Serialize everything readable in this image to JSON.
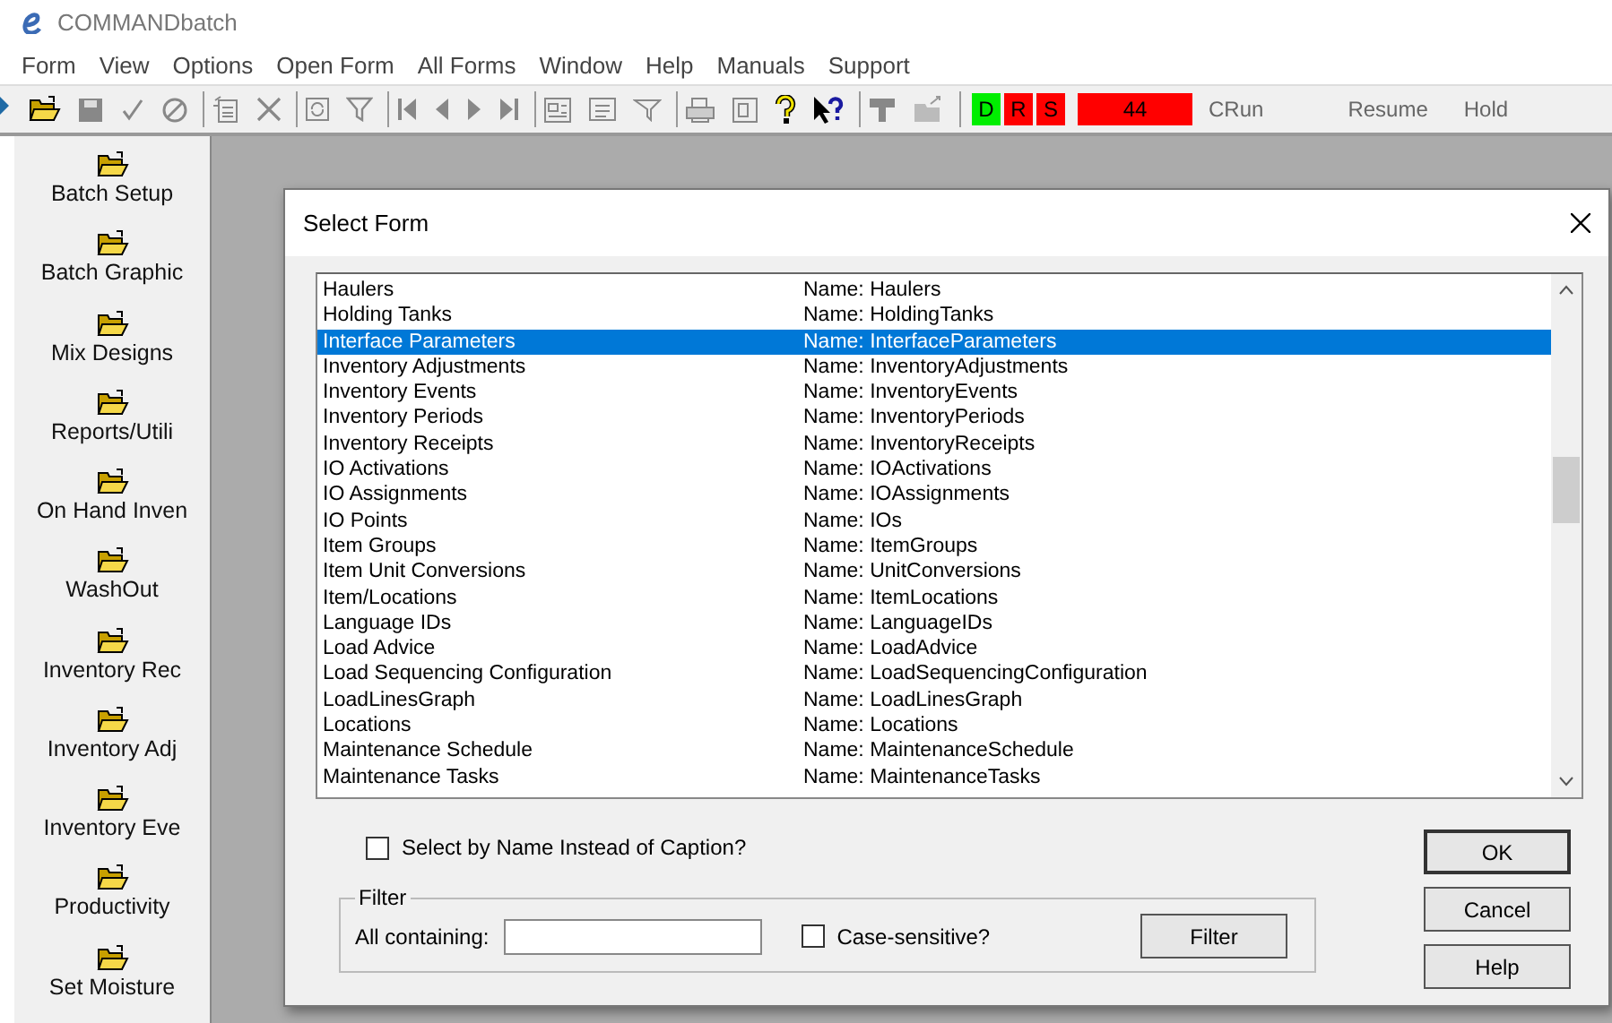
{
  "window": {
    "title": "COMMANDbatch"
  },
  "menu": [
    "Form",
    "View",
    "Options",
    "Open Form",
    "All Forms",
    "Window",
    "Help",
    "Manuals",
    "Support"
  ],
  "status": {
    "indicators": [
      {
        "label": "D",
        "color": "#00ee00"
      },
      {
        "label": "R",
        "color": "#ff0000"
      },
      {
        "label": "S",
        "color": "#ff0000"
      }
    ],
    "count": "44",
    "mode": "CRun",
    "buttons": [
      "Resume",
      "Hold"
    ]
  },
  "sidebar": {
    "items": [
      "Batch Setup",
      "Batch Graphic",
      "Mix Designs",
      "Reports/Utili",
      "On Hand Inven",
      "WashOut",
      "Inventory Rec",
      "Inventory Adj",
      "Inventory Eve",
      "Productivity",
      "Set Moisture"
    ]
  },
  "dialog": {
    "title": "Select Form",
    "rows": [
      {
        "caption": "Haulers",
        "name": "Name: Haulers",
        "selected": false
      },
      {
        "caption": "Holding Tanks",
        "name": "Name: HoldingTanks",
        "selected": false
      },
      {
        "caption": "Interface Parameters",
        "name": "Name: InterfaceParameters",
        "selected": true
      },
      {
        "caption": "Inventory Adjustments",
        "name": "Name: InventoryAdjustments",
        "selected": false
      },
      {
        "caption": "Inventory Events",
        "name": "Name: InventoryEvents",
        "selected": false
      },
      {
        "caption": "Inventory Periods",
        "name": "Name: InventoryPeriods",
        "selected": false
      },
      {
        "caption": "Inventory Receipts",
        "name": "Name: InventoryReceipts",
        "selected": false
      },
      {
        "caption": "IO Activations",
        "name": "Name: IOActivations",
        "selected": false
      },
      {
        "caption": "IO Assignments",
        "name": "Name: IOAssignments",
        "selected": false
      },
      {
        "caption": "IO Points",
        "name": "Name: IOs",
        "selected": false
      },
      {
        "caption": "Item Groups",
        "name": "Name: ItemGroups",
        "selected": false
      },
      {
        "caption": "Item Unit Conversions",
        "name": "Name: UnitConversions",
        "selected": false
      },
      {
        "caption": "Item/Locations",
        "name": "Name: ItemLocations",
        "selected": false
      },
      {
        "caption": "Language IDs",
        "name": "Name: LanguageIDs",
        "selected": false
      },
      {
        "caption": "Load Advice",
        "name": "Name: LoadAdvice",
        "selected": false
      },
      {
        "caption": "Load Sequencing Configuration",
        "name": "Name: LoadSequencingConfiguration",
        "selected": false
      },
      {
        "caption": "LoadLinesGraph",
        "name": "Name: LoadLinesGraph",
        "selected": false
      },
      {
        "caption": "Locations",
        "name": "Name: Locations",
        "selected": false
      },
      {
        "caption": "Maintenance Schedule",
        "name": "Name: MaintenanceSchedule",
        "selected": false
      },
      {
        "caption": "Maintenance Tasks",
        "name": "Name: MaintenanceTasks",
        "selected": false
      }
    ],
    "select_by_name": {
      "label": "Select by Name Instead of Caption?",
      "checked": false
    },
    "filter": {
      "title": "Filter",
      "label": "All containing:",
      "case_sensitive": {
        "label": "Case-sensitive?",
        "checked": false
      },
      "button": "Filter"
    },
    "buttons": [
      "OK",
      "Cancel",
      "Help"
    ]
  }
}
